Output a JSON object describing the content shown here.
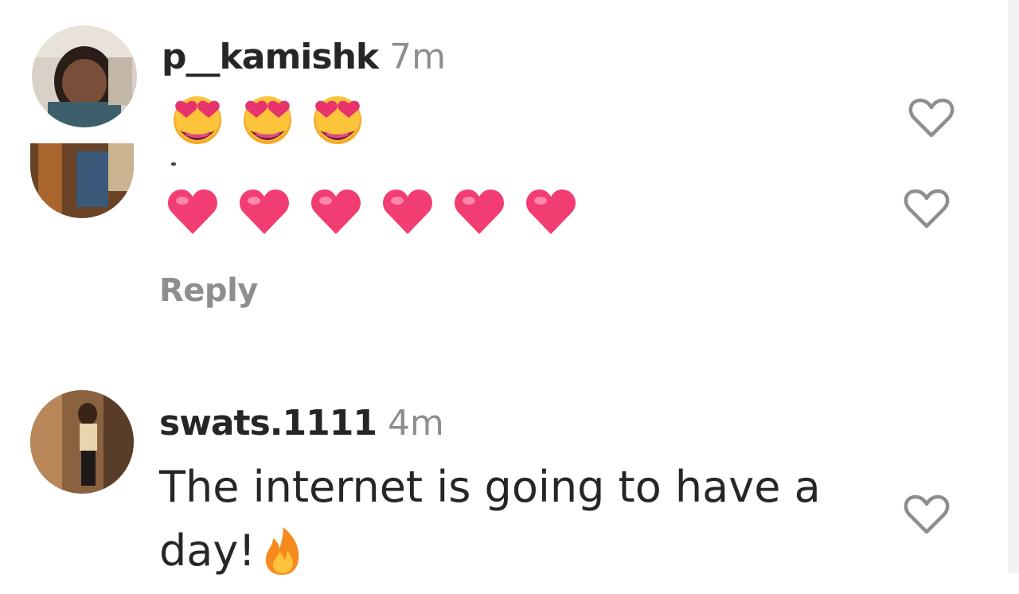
{
  "comments": [
    {
      "username": "p__kamishk",
      "time": "7m",
      "emoji_icons": [
        "smiling-face-heart-eyes-icon",
        "smiling-face-heart-eyes-icon",
        "smiling-face-heart-eyes-icon"
      ]
    },
    {
      "emoji_icons": [
        "red-heart-icon",
        "red-heart-icon",
        "red-heart-icon",
        "red-heart-icon",
        "red-heart-icon",
        "red-heart-icon"
      ],
      "reply_label": "Reply"
    },
    {
      "username": "swats.1111",
      "time": "4m",
      "text_line1": "The internet is going to have a",
      "text_line2": "day!",
      "emoji_icon": "fire-icon"
    }
  ],
  "colors": {
    "username": "#262626",
    "meta_gray": "#8e8e8e",
    "heart_pink": "#f23d73",
    "like_outline": "#8e8e8e"
  }
}
